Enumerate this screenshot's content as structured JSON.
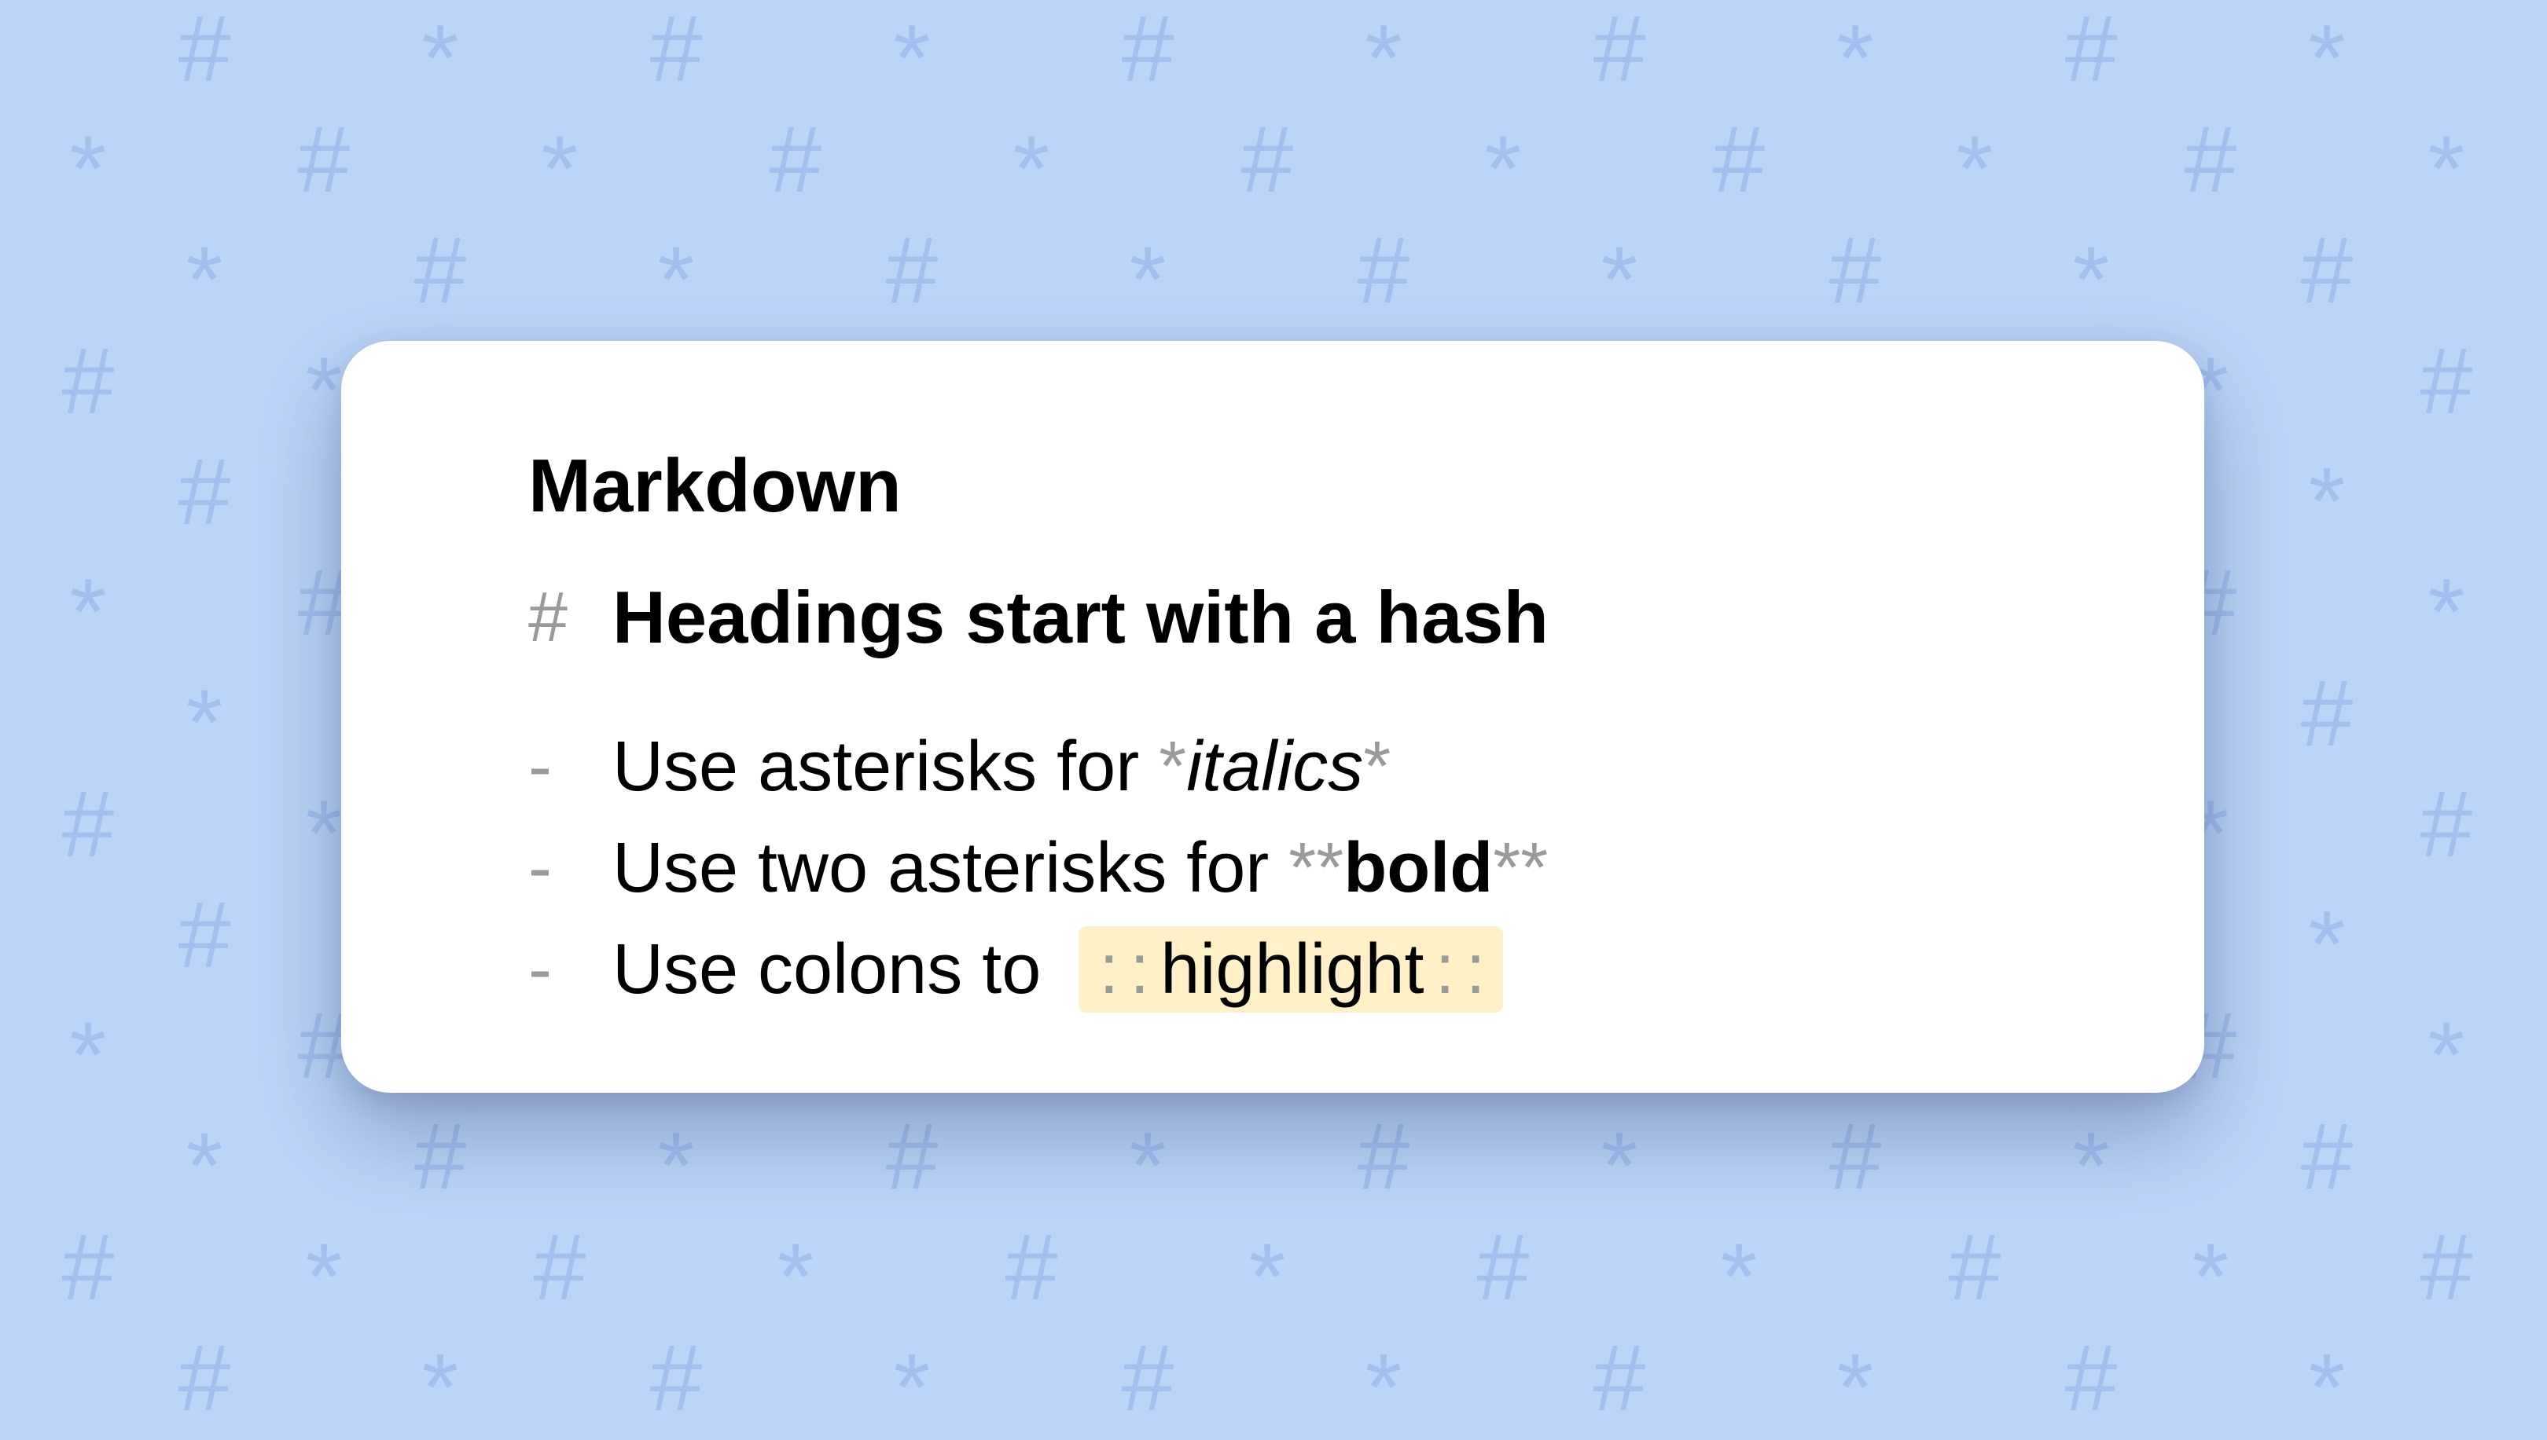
{
  "background": {
    "symbols": [
      "#",
      "*"
    ],
    "color": "#bcd4f8",
    "symbol_color": "#a3bfee"
  },
  "card": {
    "title": "Markdown",
    "lines": [
      {
        "marker": "#",
        "text": "Headings start with a hash"
      },
      {
        "marker": "-",
        "text": "Use asterisks for ",
        "syntax_open": "*",
        "styled": "italics",
        "syntax_close": "*"
      },
      {
        "marker": "-",
        "text": "Use two asterisks for ",
        "syntax_open": "**",
        "styled": "bold",
        "syntax_close": "**"
      },
      {
        "marker": "-",
        "text": "Use colons to",
        "syntax_open": "::",
        "styled": "highlight",
        "syntax_close": "::"
      }
    ],
    "highlight_color": "#fff0c7"
  }
}
